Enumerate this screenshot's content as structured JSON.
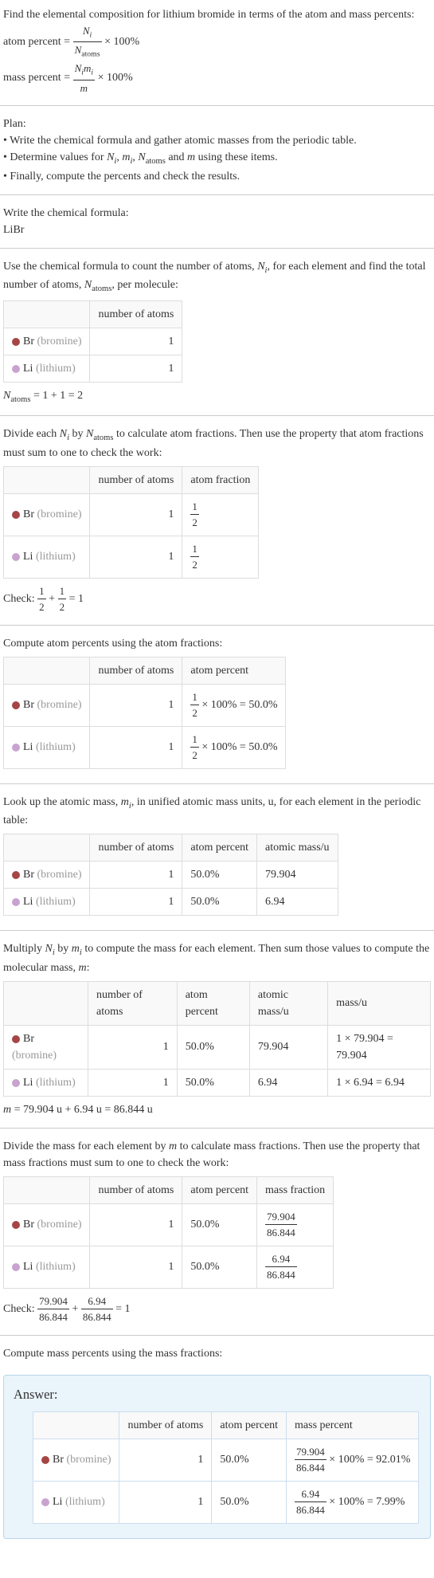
{
  "intro": {
    "line1": "Find the elemental composition for lithium bromide in terms of the atom and mass percents:",
    "atom_percent_label": "atom percent = ",
    "atom_num": "N",
    "atom_sub_i": "i",
    "atom_den": "N",
    "atom_sub_atoms": "atoms",
    "times100": " × 100%",
    "mass_percent_label": "mass percent = ",
    "mass_num1": "N",
    "mass_num2": "m",
    "mass_den": "m"
  },
  "plan": {
    "heading": "Plan:",
    "b1_a": "• Write the chemical formula and gather atomic masses from the periodic table.",
    "b2_pre": "• Determine values for ",
    "b2_N": "N",
    "b2_i": "i",
    "b2_c1": ", ",
    "b2_m": "m",
    "b2_c2": ", ",
    "b2_Natoms": "N",
    "b2_atoms": "atoms",
    "b2_and": " and ",
    "b2_mm": "m",
    "b2_post": " using these items.",
    "b3": "• Finally, compute the percents and check the results."
  },
  "formula": {
    "heading": "Write the chemical formula:",
    "value": "LiBr"
  },
  "count": {
    "text_a": "Use the chemical formula to count the number of atoms, ",
    "N": "N",
    "i": "i",
    "text_b": ", for each element and find the total number of atoms, ",
    "Natoms": "N",
    "atoms": "atoms",
    "text_c": ", per molecule:",
    "col_atoms": "number of atoms",
    "br_label": "Br",
    "br_paren": " (bromine)",
    "br_n": "1",
    "li_label": "Li",
    "li_paren": " (lithium)",
    "li_n": "1",
    "eq_lhs_N": "N",
    "eq_lhs_atoms": "atoms",
    "eq_rhs": " = 1 + 1 = 2"
  },
  "atomfrac": {
    "text_a": "Divide each ",
    "N": "N",
    "i": "i",
    "text_b": " by ",
    "Natoms": "N",
    "atoms": "atoms",
    "text_c": " to calculate atom fractions. Then use the property that atom fractions must sum to one to check the work:",
    "col_atoms": "number of atoms",
    "col_frac": "atom fraction",
    "br_n": "1",
    "li_n": "1",
    "frac_num": "1",
    "frac_den": "2",
    "check_label": "Check: ",
    "check_plus": " + ",
    "check_eq": " = 1"
  },
  "atompct": {
    "heading": "Compute atom percents using the atom fractions:",
    "col_atoms": "number of atoms",
    "col_pct": "atom percent",
    "br_n": "1",
    "li_n": "1",
    "frac_num": "1",
    "frac_den": "2",
    "pct_tail": " × 100% = 50.0%"
  },
  "atomicmass": {
    "text_a": "Look up the atomic mass, ",
    "m": "m",
    "i": "i",
    "text_b": ", in unified atomic mass units, u, for each element in the periodic table:",
    "col_atoms": "number of atoms",
    "col_pct": "atom percent",
    "col_mass": "atomic mass/u",
    "br_n": "1",
    "br_pct": "50.0%",
    "br_mass": "79.904",
    "li_n": "1",
    "li_pct": "50.0%",
    "li_mass": "6.94"
  },
  "molmass": {
    "text_a": "Multiply ",
    "N": "N",
    "i": "i",
    "text_b": " by ",
    "m": "m",
    "text_c": " to compute the mass for each element. Then sum those values to compute the molecular mass, ",
    "mm": "m",
    "text_d": ":",
    "col_atoms": "number of atoms",
    "col_pct": "atom percent",
    "col_amass": "atomic mass/u",
    "col_mass": "mass/u",
    "br_n": "1",
    "br_pct": "50.0%",
    "br_amass": "79.904",
    "br_mass": "1 × 79.904 = 79.904",
    "li_n": "1",
    "li_pct": "50.0%",
    "li_amass": "6.94",
    "li_mass": "1 × 6.94 = 6.94",
    "eq_m": "m",
    "eq_rhs": " = 79.904 u + 6.94 u = 86.844 u"
  },
  "massfrac": {
    "text_a": "Divide the mass for each element by ",
    "m": "m",
    "text_b": " to calculate mass fractions. Then use the property that mass fractions must sum to one to check the work:",
    "col_atoms": "number of atoms",
    "col_pct": "atom percent",
    "col_frac": "mass fraction",
    "br_n": "1",
    "br_pct": "50.0%",
    "br_num": "79.904",
    "br_den": "86.844",
    "li_n": "1",
    "li_pct": "50.0%",
    "li_num": "6.94",
    "li_den": "86.844",
    "check_label": "Check: ",
    "check_plus": " + ",
    "check_eq": " = 1"
  },
  "masspct": {
    "heading": "Compute mass percents using the mass fractions:"
  },
  "answer": {
    "heading": "Answer:",
    "col_atoms": "number of atoms",
    "col_apct": "atom percent",
    "col_mpct": "mass percent",
    "br_label": "Br",
    "br_paren": " (bromine)",
    "br_n": "1",
    "br_apct": "50.0%",
    "br_num": "79.904",
    "br_den": "86.844",
    "br_tail": " × 100% = 92.01%",
    "li_label": "Li",
    "li_paren": " (lithium)",
    "li_n": "1",
    "li_apct": "50.0%",
    "li_num": "6.94",
    "li_den": "86.844",
    "li_tail": " × 100% = 7.99%"
  }
}
